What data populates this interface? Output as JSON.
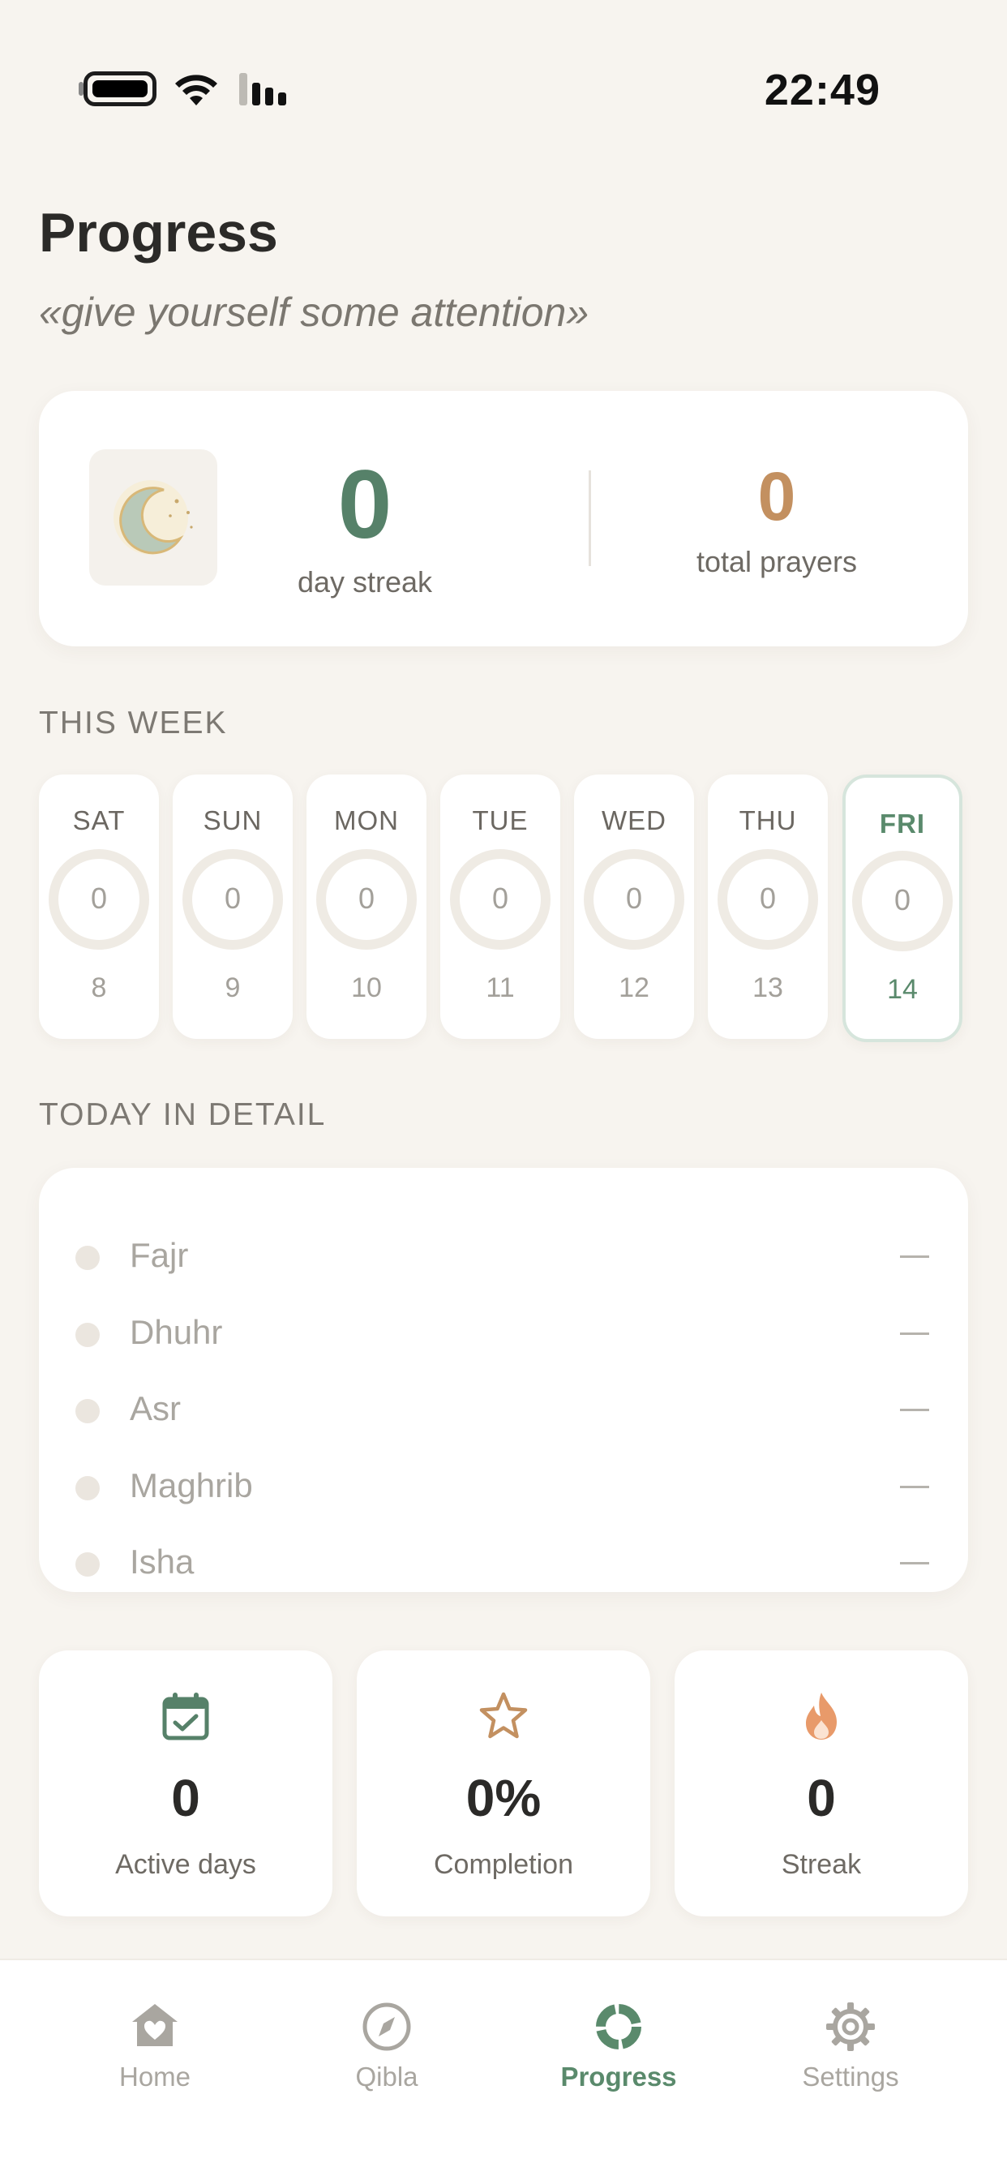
{
  "status_bar": {
    "time": "22:49"
  },
  "header": {
    "title": "Progress",
    "subtitle": "«give yourself some attention»"
  },
  "summary": {
    "streak_value": "0",
    "streak_label": "day streak",
    "total_value": "0",
    "total_label": "total prayers"
  },
  "week": {
    "heading": "THIS WEEK",
    "days": [
      {
        "name": "SAT",
        "count": "0",
        "date": "8"
      },
      {
        "name": "SUN",
        "count": "0",
        "date": "9"
      },
      {
        "name": "MON",
        "count": "0",
        "date": "10"
      },
      {
        "name": "TUE",
        "count": "0",
        "date": "11"
      },
      {
        "name": "WED",
        "count": "0",
        "date": "12"
      },
      {
        "name": "THU",
        "count": "0",
        "date": "13"
      },
      {
        "name": "FRI",
        "count": "0",
        "date": "14"
      }
    ]
  },
  "today_detail": {
    "heading": "TODAY IN DETAIL",
    "prayers": [
      {
        "name": "Fajr"
      },
      {
        "name": "Dhuhr"
      },
      {
        "name": "Asr"
      },
      {
        "name": "Maghrib"
      },
      {
        "name": "Isha"
      }
    ]
  },
  "stats": [
    {
      "value": "0",
      "label": "Active days",
      "icon": "calendar-check-icon"
    },
    {
      "value": "0%",
      "label": "Completion",
      "icon": "star-icon"
    },
    {
      "value": "0",
      "label": "Streak",
      "icon": "flame-icon"
    }
  ],
  "tabs": [
    {
      "label": "Home",
      "icon": "home-heart-icon"
    },
    {
      "label": "Qibla",
      "icon": "compass-icon"
    },
    {
      "label": "Progress",
      "icon": "progress-ring-icon",
      "active": true
    },
    {
      "label": "Settings",
      "icon": "gear-icon"
    }
  ],
  "colors": {
    "background": "#f7f4ef",
    "accent_green": "#568169",
    "accent_gold": "#c39060",
    "flame": "#e89a6a"
  }
}
